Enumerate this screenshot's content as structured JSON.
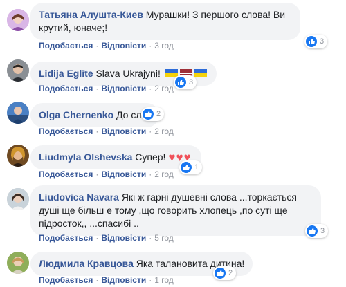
{
  "comments": [
    {
      "author": "Татьяна Алушта-Киев",
      "text": "Мурашки! З першого слова! Ви крутий, юначе;!",
      "like_label": "Подобається",
      "reply_label": "Відповісти",
      "time": "3 год",
      "reaction_count": "3",
      "avatar_color": "#c39ad8"
    },
    {
      "author": "Lidija Eglīte",
      "text": "Slava Ukrajyni!",
      "like_label": "Подобається",
      "reply_label": "Відповісти",
      "time": "2 год",
      "reaction_count": "3",
      "avatar_color": "#5a6570"
    },
    {
      "author": "Olga Chernenko",
      "text": "До сліз!",
      "like_label": "Подобається",
      "reply_label": "Відповісти",
      "time": "2 год",
      "reaction_count": "2",
      "avatar_color": "#3f6fa8"
    },
    {
      "author": "Liudmyla Olshevska",
      "text": "Супер!",
      "like_label": "Подобається",
      "reply_label": "Відповісти",
      "time": "2 год",
      "reaction_count": "1",
      "avatar_color": "#c08a3a"
    },
    {
      "author": "Liudovica Navara",
      "text": "Які ж гарні душевні слова ...торкається душі ще більш е тому ,що говорить хлопець ,по суті ще підросток,, ...спасибі ..",
      "like_label": "Подобається",
      "reply_label": "Відповісти",
      "time": "5 год",
      "reaction_count": "3",
      "avatar_color": "#b8c4cc"
    },
    {
      "author": "Людмила Кравцова",
      "text": "Яка талановита дитина!",
      "like_label": "Подобається",
      "reply_label": "Відповісти",
      "time": "1 год",
      "reaction_count": "2",
      "avatar_color": "#7a9a4a"
    }
  ],
  "colors": {
    "name": "#385898",
    "bubble": "#f2f3f5",
    "like_blue": "#1877f2",
    "meta_gray": "#90949c"
  }
}
